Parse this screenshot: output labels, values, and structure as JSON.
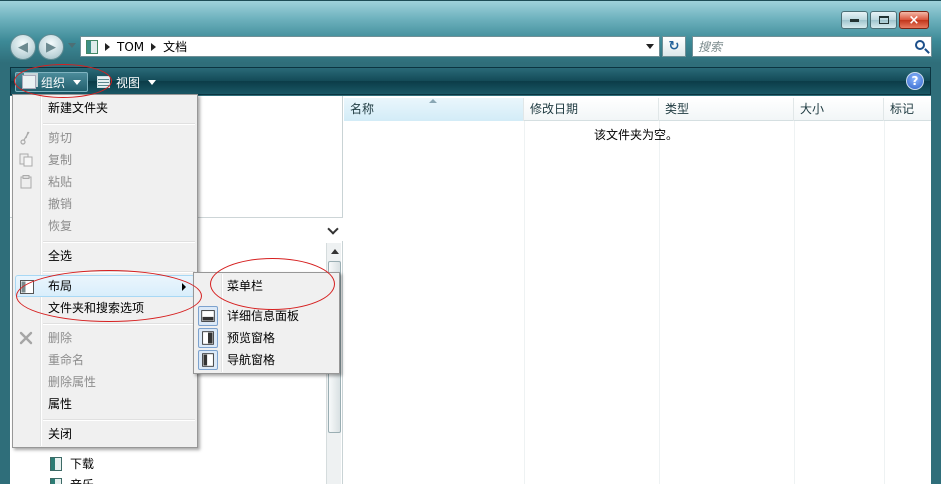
{
  "window": {
    "controls": {
      "minimize": "minimize",
      "maximize": "maximize",
      "close": "×"
    }
  },
  "nav": {
    "back_glyph": "◀",
    "forward_glyph": "▶",
    "breadcrumb": [
      "TOM",
      "文档"
    ],
    "refresh_glyph": "↻",
    "search_placeholder": "搜索"
  },
  "toolbar": {
    "organize_label": "组织",
    "views_label": "视图",
    "help_label": "?"
  },
  "columns": [
    "名称",
    "修改日期",
    "类型",
    "大小",
    "标记"
  ],
  "empty_message": "该文件夹为空。",
  "tree": [
    {
      "label": "下载"
    },
    {
      "label": "音乐"
    }
  ],
  "menu": {
    "items": [
      {
        "label": "新建文件夹",
        "enabled": true
      },
      {
        "label": "剪切",
        "enabled": false,
        "icon": "scissors-icon"
      },
      {
        "label": "复制",
        "enabled": false,
        "icon": "copy-icon"
      },
      {
        "label": "粘贴",
        "enabled": false,
        "icon": "paste-icon"
      },
      {
        "label": "撤销",
        "enabled": false
      },
      {
        "label": "恢复",
        "enabled": false
      },
      {
        "label": "全选",
        "enabled": true
      },
      {
        "label": "布局",
        "enabled": true,
        "icon": "layout-icon",
        "submenu": true
      },
      {
        "label": "文件夹和搜索选项",
        "enabled": true
      },
      {
        "label": "删除",
        "enabled": false,
        "icon": "delete-x-icon"
      },
      {
        "label": "重命名",
        "enabled": false
      },
      {
        "label": "删除属性",
        "enabled": false
      },
      {
        "label": "属性",
        "enabled": true
      },
      {
        "label": "关闭",
        "enabled": true
      }
    ]
  },
  "layout_submenu": {
    "items": [
      {
        "label": "菜单栏",
        "icon": null
      },
      {
        "label": "详细信息面板",
        "icon": "details-pane-icon"
      },
      {
        "label": "预览窗格",
        "icon": "preview-pane-icon"
      },
      {
        "label": "导航窗格",
        "icon": "navigation-pane-icon"
      }
    ]
  },
  "colors": {
    "annotation_red": "#d62020",
    "toolbar_dark": "#134a57",
    "menu_bg": "#f0f0f0"
  }
}
